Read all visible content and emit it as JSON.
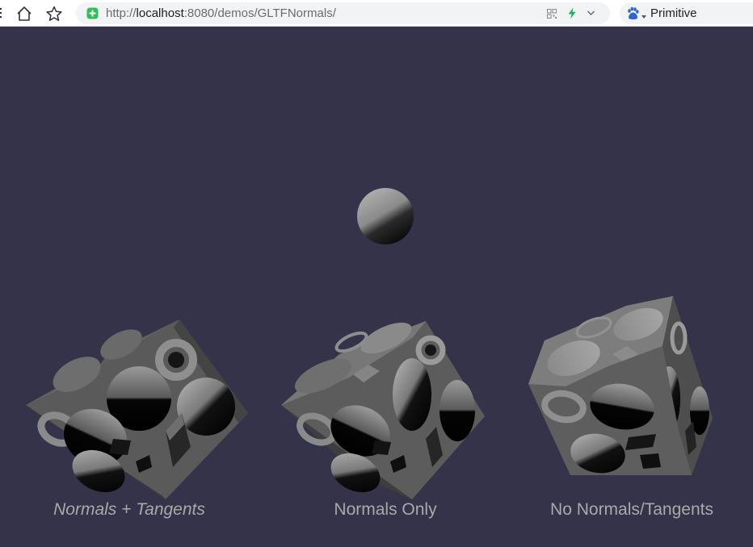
{
  "browser": {
    "url_scheme": "http://",
    "url_host": "localhost",
    "url_rest": ":8080/demos/GLTFNormals/",
    "search_engine_label": "Primitive",
    "icons": {
      "home": "home-icon",
      "favorite": "star-icon",
      "security": "shield-icon",
      "qr": "qr-code-icon",
      "accelerate": "lightning-icon",
      "dropdown": "chevron-down-icon",
      "engine": "baidu-paw-icon"
    }
  },
  "scene": {
    "background_color": "#343349",
    "models": [
      {
        "label": "Normals + Tangents"
      },
      {
        "label": "Normals Only"
      },
      {
        "label": "No Normals/Tangents"
      }
    ]
  }
}
